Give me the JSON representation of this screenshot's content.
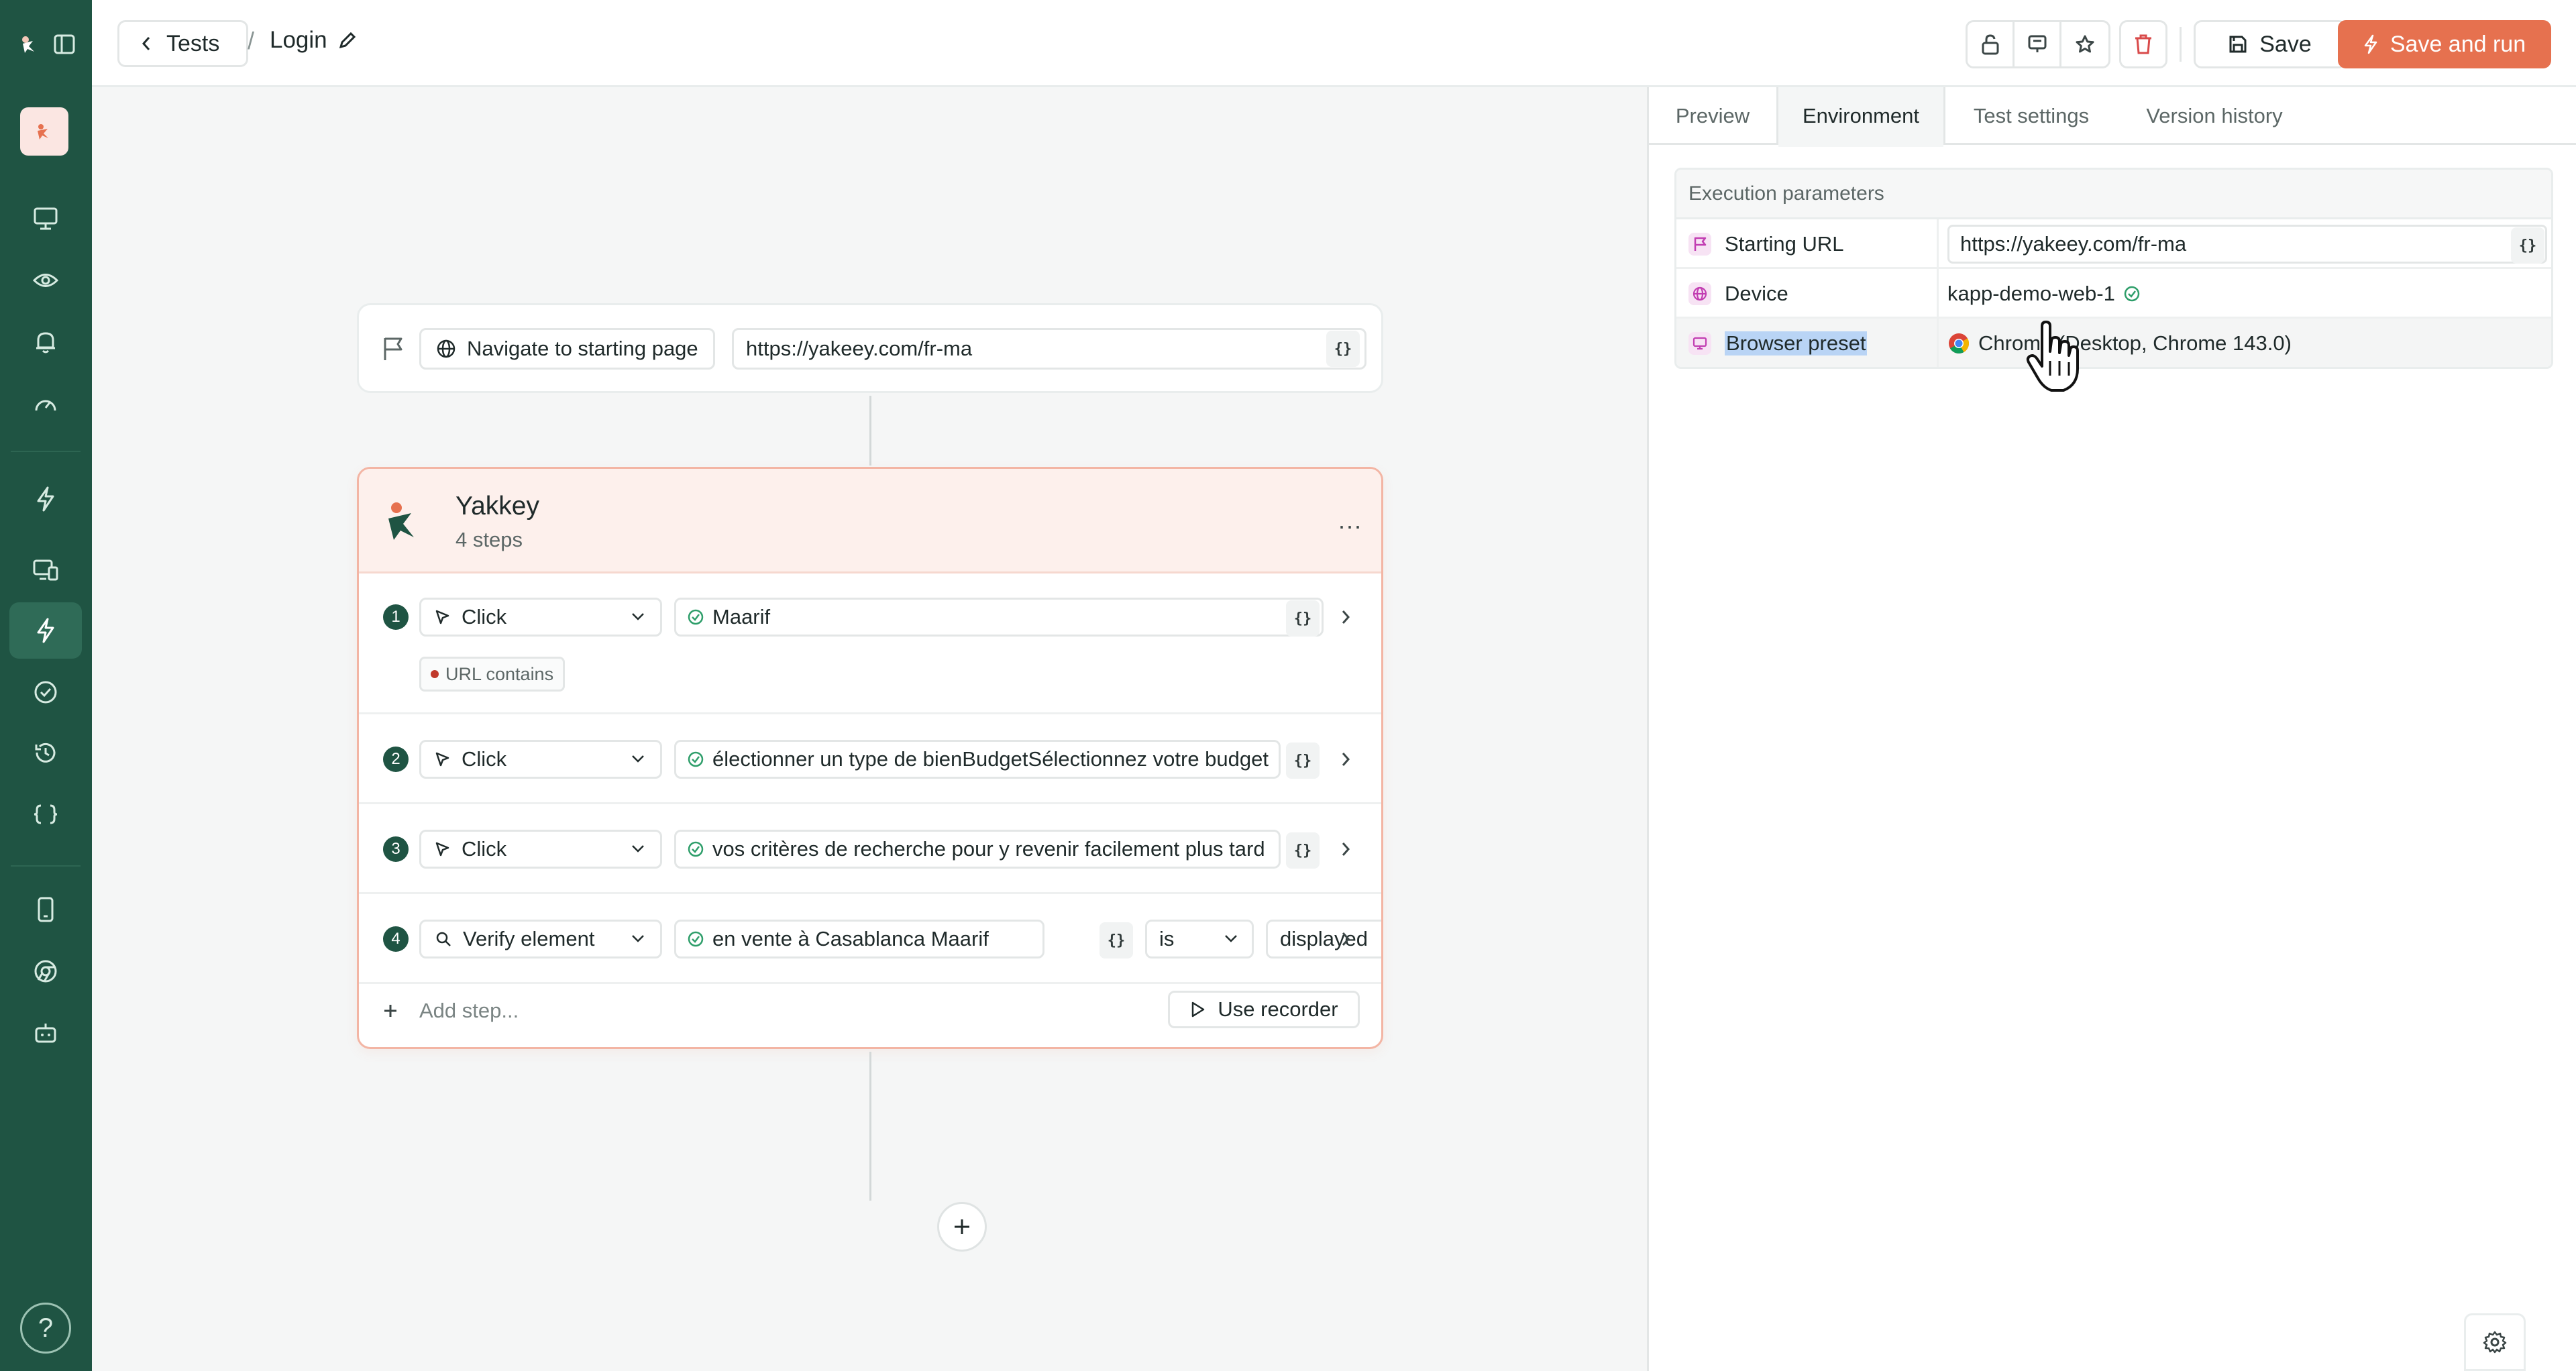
{
  "topbar": {
    "back_label": "Tests",
    "breadcrumb_separator": "/",
    "test_name": "Login",
    "save_label": "Save",
    "save_and_run_label": "Save and run"
  },
  "canvas": {
    "start_node": {
      "action_label": "Navigate to starting page",
      "url": "https://yakeey.com/fr-ma",
      "var_label": "{}"
    },
    "group": {
      "title": "Yakkey",
      "subtitle": "4 steps",
      "more_label": "...",
      "steps": [
        {
          "number": "1",
          "action": "Click",
          "target": "Maarif",
          "var_label": "{}",
          "assertion_badge": "URL contains"
        },
        {
          "number": "2",
          "action": "Click",
          "target": "électionner un type de bienBudgetSélectionnez votre budget",
          "var_label": "{}"
        },
        {
          "number": "3",
          "action": "Click",
          "target": "vos critères de recherche pour y revenir facilement plus tard",
          "var_label": "{}"
        },
        {
          "number": "4",
          "action": "Verify element",
          "target": "en vente à Casablanca Maarif",
          "var_label": "{}",
          "operator": "is",
          "condition": "displayed"
        }
      ],
      "add_step_label": "Add step...",
      "recorder_label": "Use recorder"
    }
  },
  "panel": {
    "tabs": [
      {
        "label": "Preview",
        "active": false
      },
      {
        "label": "Environment",
        "active": true
      },
      {
        "label": "Test settings",
        "active": false
      },
      {
        "label": "Version history",
        "active": false
      }
    ],
    "section_title": "Execution parameters",
    "params": [
      {
        "label": "Starting URL",
        "value": "https://yakeey.com/fr-ma",
        "icon": "flag-icon",
        "var_label": "{}"
      },
      {
        "label": "Device",
        "value": "kapp-demo-web-1",
        "icon": "globe-icon"
      },
      {
        "label": "Browser preset",
        "value": "Chrome (Desktop, Chrome 143.0)",
        "icon": "monitor-icon"
      }
    ]
  },
  "rail": {
    "help_label": "?"
  },
  "colors": {
    "rail_bg": "#1f5443",
    "accent": "#e6714f",
    "step_badge": "#1f5443",
    "group_header_bg": "#fdf0ec",
    "group_border": "#f3b5a4",
    "success": "#2e9e6a"
  }
}
